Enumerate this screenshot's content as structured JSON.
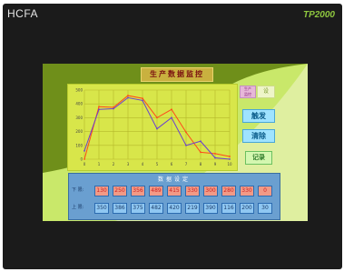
{
  "device": {
    "brand": "HCFA",
    "model": "TP2000"
  },
  "screen": {
    "title": "生产数据监控",
    "chip_label_top": "生产",
    "chip_label_bottom": "监控",
    "set_button": "设",
    "buttons": [
      "触发",
      "清除",
      "记录"
    ],
    "panel": {
      "title": "数据设定",
      "row1_label": "下 限:",
      "row2_label": "上 限:",
      "row1_values": [
        "130",
        "250",
        "356",
        "489",
        "415",
        "330",
        "300",
        "280",
        "330",
        "0"
      ],
      "row2_values": [
        "350",
        "386",
        "375",
        "482",
        "420",
        "219",
        "390",
        "116",
        "200",
        "30"
      ]
    }
  },
  "chart_data": {
    "type": "line",
    "x": [
      0,
      1,
      2,
      3,
      4,
      5,
      6,
      7,
      8,
      9,
      10
    ],
    "y_ticks": [
      0,
      100,
      200,
      300,
      400,
      500
    ],
    "x_ticks": [
      0,
      1,
      2,
      3,
      4,
      5,
      6,
      7,
      8,
      9,
      10
    ],
    "ylim": [
      0,
      500
    ],
    "xlim": [
      0,
      10
    ],
    "series": [
      {
        "values": [
          0,
          380,
          375,
          460,
          440,
          300,
          360,
          195,
          50,
          40,
          20
        ],
        "color": "#ff4a1a"
      },
      {
        "values": [
          60,
          360,
          365,
          445,
          425,
          220,
          300,
          100,
          130,
          10,
          0
        ],
        "color": "#6a3fd0"
      }
    ]
  }
}
